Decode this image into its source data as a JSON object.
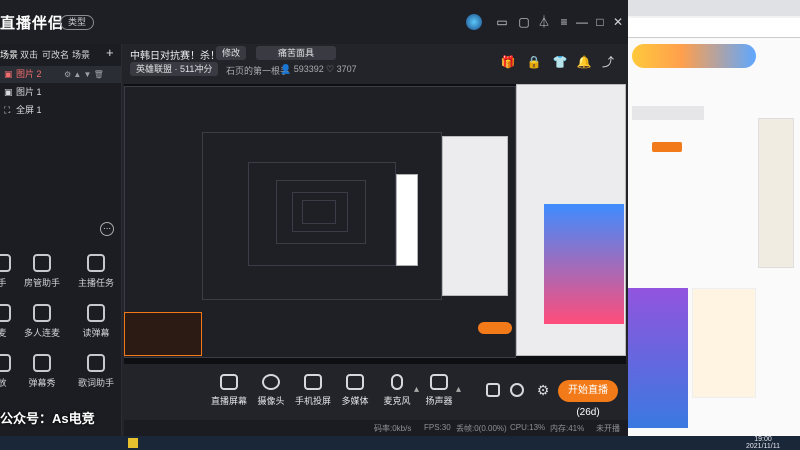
{
  "app": {
    "logo_text": "直播伴侣",
    "type_pill": "类型",
    "room_title": "中韩日对抗赛！杀！",
    "edit_btn": "修改",
    "notice": "痛苦面具",
    "category": "英雄联盟 · 511冲分",
    "game_name": "石页的第一根手",
    "viewers": "593392",
    "likes": "3707"
  },
  "left_panel": {
    "tabs": [
      "场景",
      "双击",
      "可改名",
      "场景"
    ],
    "add_label": "+",
    "scenes": [
      "图片 2",
      "图片 1",
      "全屏 1"
    ],
    "tools": [
      {
        "label": "手",
        "name": "partial-tool-left-1"
      },
      {
        "label": "房管助手",
        "name": "room-manager-tool"
      },
      {
        "label": "主播任务",
        "name": "streamer-task-tool"
      },
      {
        "label": "麦",
        "name": "partial-tool-left-2"
      },
      {
        "label": "多人连麦",
        "name": "multi-mic-tool"
      },
      {
        "label": "读弹幕",
        "name": "read-danmaku-tool"
      },
      {
        "label": "放",
        "name": "partial-tool-left-3"
      },
      {
        "label": "弹幕秀",
        "name": "danmaku-show-tool"
      },
      {
        "label": "歌词助手",
        "name": "lyrics-assist-tool"
      }
    ]
  },
  "toolbar": {
    "items": [
      "直播屏幕",
      "摄像头",
      "手机投屏",
      "多媒体",
      "麦克风",
      "扬声器"
    ],
    "start_label": "开始直播(26d)"
  },
  "status": {
    "bitrate": "码率:0kb/s",
    "fps": "FPS:30",
    "drop": "丢帧:0(0.00%)",
    "cpu": "CPU:13%",
    "mem": "内存:41%",
    "notstarted": "未开播"
  },
  "watermark": "公众号：As电竞",
  "taskbar": {
    "time": "19:00",
    "date": "2021/11/11"
  },
  "colors": {
    "accent": "#f37a18",
    "bg": "#232429"
  }
}
